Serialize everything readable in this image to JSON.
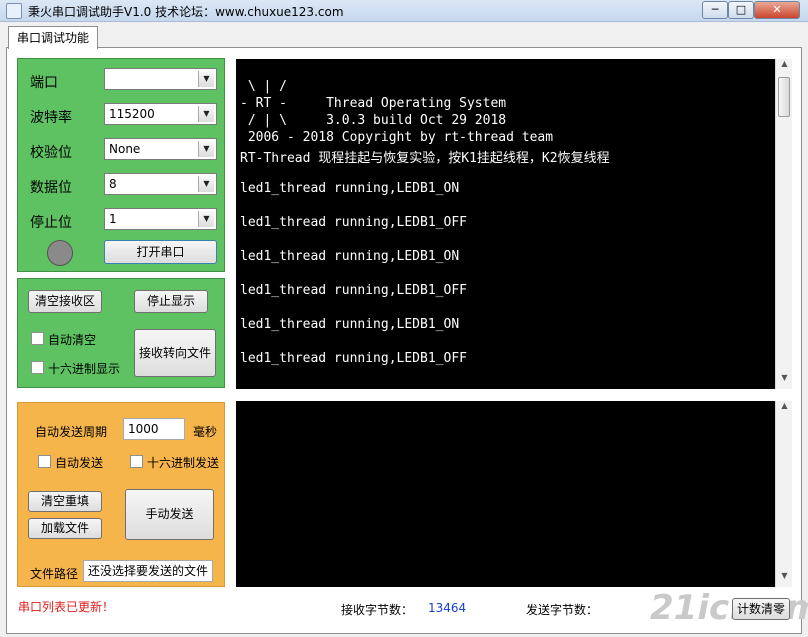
{
  "window": {
    "title": "秉火串口调试助手V1.0     技术论坛：www.chuxue123.com",
    "minimize_glyph": "─",
    "maximize_glyph": "□",
    "close_glyph": "✕"
  },
  "tabs": [
    {
      "label": "串口调试功能",
      "selected": true
    }
  ],
  "serial_settings": {
    "port_label": "端口",
    "port_value": "",
    "baud_label": "波特率",
    "baud_value": "115200",
    "parity_label": "校验位",
    "parity_value": "None",
    "databits_label": "数据位",
    "databits_value": "8",
    "stopbits_label": "停止位",
    "stopbits_value": "1",
    "status_led_color": "#8a8a8a",
    "open_button": "打开串口"
  },
  "receive_options": {
    "clear_button": "清空接收区",
    "stop_button": "停止显示",
    "auto_clear_label": "自动清空",
    "auto_clear_checked": false,
    "hex_display_label": "十六进制显示",
    "hex_display_checked": false,
    "redirect_button": "接收转向文件"
  },
  "send_options": {
    "period_label": "自动发送周期",
    "period_value": "1000",
    "period_unit": "毫秒",
    "auto_send_label": "自动发送",
    "auto_send_checked": false,
    "hex_send_label": "十六进制发送",
    "hex_send_checked": false,
    "clear_refill_button": "清空重填",
    "load_file_button": "加载文件",
    "manual_send_button": "手动发送",
    "file_path_label": "文件路径",
    "file_path_value": "还没选择要发送的文件"
  },
  "receive_area": {
    "lines": [
      " \\ | /",
      "- RT -     Thread Operating System",
      " / | \\     3.0.3 build Oct 29 2018",
      " 2006 - 2018 Copyright by rt-thread team",
      "RT-Thread 现程挂起与恢复实验，按K1挂起线程，K2恢复线程",
      "",
      "led1_thread running,LEDB1_ON",
      "",
      "led1_thread running,LEDB1_OFF",
      "",
      "led1_thread running,LEDB1_ON",
      "",
      "led1_thread running,LEDB1_OFF",
      "",
      "led1_thread running,LEDB1_ON",
      "",
      "led1_thread running,LEDB1_OFF"
    ]
  },
  "send_area": {
    "text": ""
  },
  "status_bar": {
    "message": "串口列表已更新！",
    "rx_label": "接收字节数：",
    "rx_value": "13464",
    "tx_label": "发送字节数：",
    "tx_value": "",
    "reset_button": "计数清零"
  },
  "watermark": "21ic.com"
}
